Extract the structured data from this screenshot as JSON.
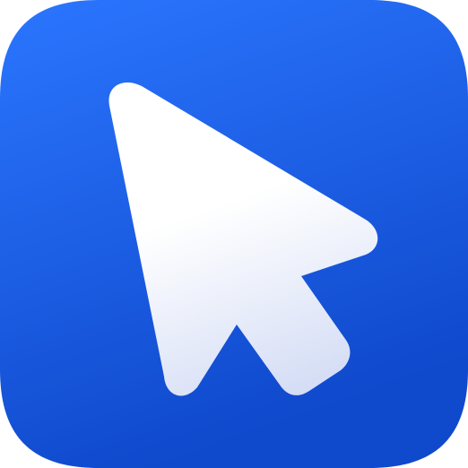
{
  "icon": {
    "name": "cursor-arrow-app-icon",
    "glyph": "mouse-pointer-arrow",
    "colors": {
      "background_top": "#2B76FF",
      "background_bottom": "#0F49CC",
      "arrow_top": "#FFFFFF",
      "arrow_bottom": "#D3DCF5"
    }
  }
}
